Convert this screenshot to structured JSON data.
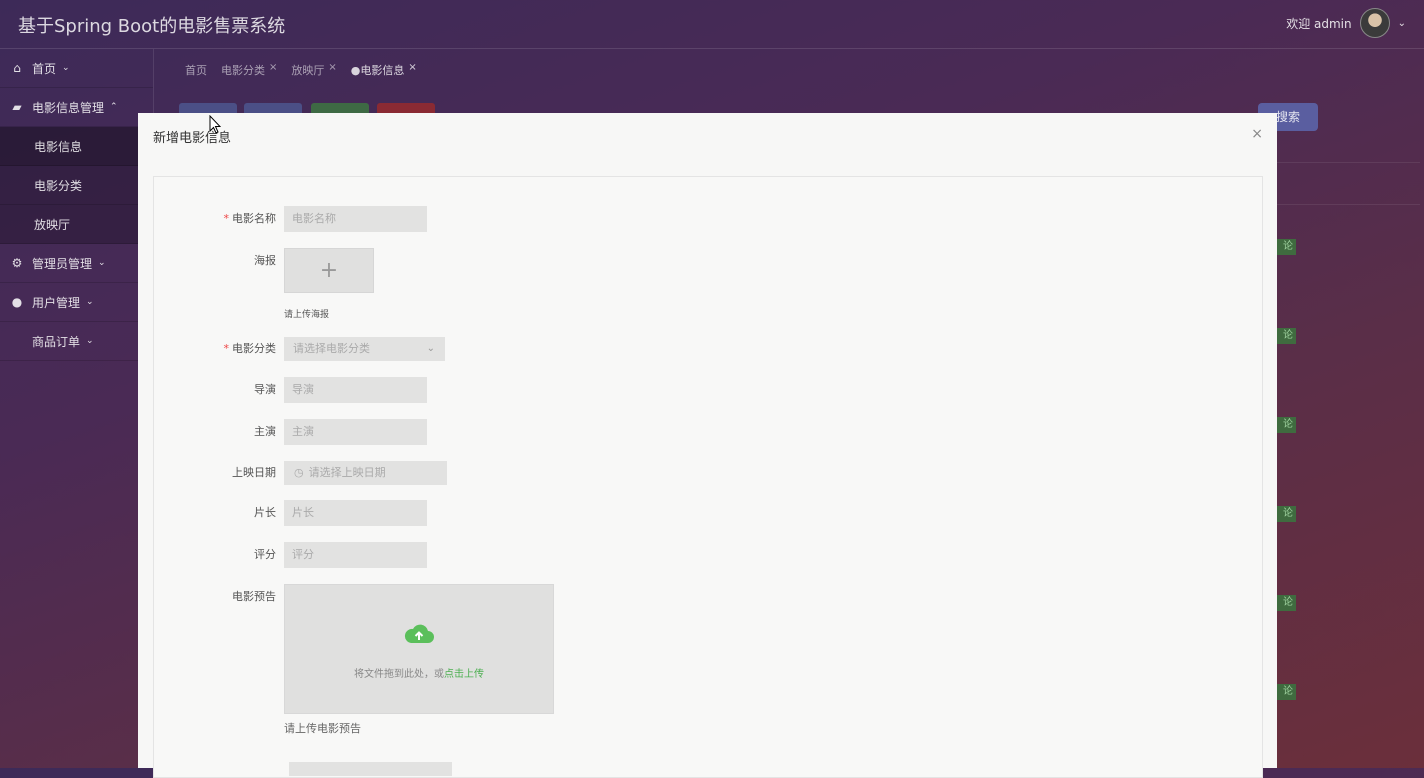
{
  "app": {
    "title": "基于Spring Boot的电影售票系统"
  },
  "user": {
    "greeting": "欢迎 admin"
  },
  "sidebar": {
    "items": [
      {
        "label": "首页",
        "icon": "home-icon"
      },
      {
        "label": "电影信息管理",
        "icon": "briefcase-icon"
      },
      {
        "label": "管理员管理",
        "icon": "gear-icon"
      },
      {
        "label": "用户管理",
        "icon": "user-icon"
      },
      {
        "label": "商品订单",
        "icon": ""
      }
    ],
    "subitems": [
      {
        "label": "电影信息",
        "active": true
      },
      {
        "label": "电影分类"
      },
      {
        "label": "放映厅"
      }
    ]
  },
  "tabs": [
    {
      "label": "首页"
    },
    {
      "label": "电影分类"
    },
    {
      "label": "放映厅"
    },
    {
      "label": "●电影信息",
      "active": true
    }
  ],
  "toolbar": {
    "search_label": "搜索",
    "row_chip_text": "论"
  },
  "modal": {
    "title": "新增电影信息",
    "close": "×",
    "fields": {
      "name": {
        "label": "电影名称",
        "placeholder": "电影名称"
      },
      "poster": {
        "label": "海报",
        "hint": "请上传海报"
      },
      "category": {
        "label": "电影分类",
        "placeholder": "请选择电影分类"
      },
      "director": {
        "label": "导演",
        "placeholder": "导演"
      },
      "cast": {
        "label": "主演",
        "placeholder": "主演"
      },
      "release": {
        "label": "上映日期",
        "placeholder": "请选择上映日期"
      },
      "duration": {
        "label": "片长",
        "placeholder": "片长"
      },
      "score": {
        "label": "评分",
        "placeholder": "评分"
      },
      "trailer": {
        "label": "电影预告",
        "drop_text": "将文件拖到此处，或",
        "drop_link": "点击上传",
        "hint": "请上传电影预告"
      }
    }
  },
  "colors": {
    "accent_green": "#4caf50",
    "required_red": "#e44444"
  }
}
